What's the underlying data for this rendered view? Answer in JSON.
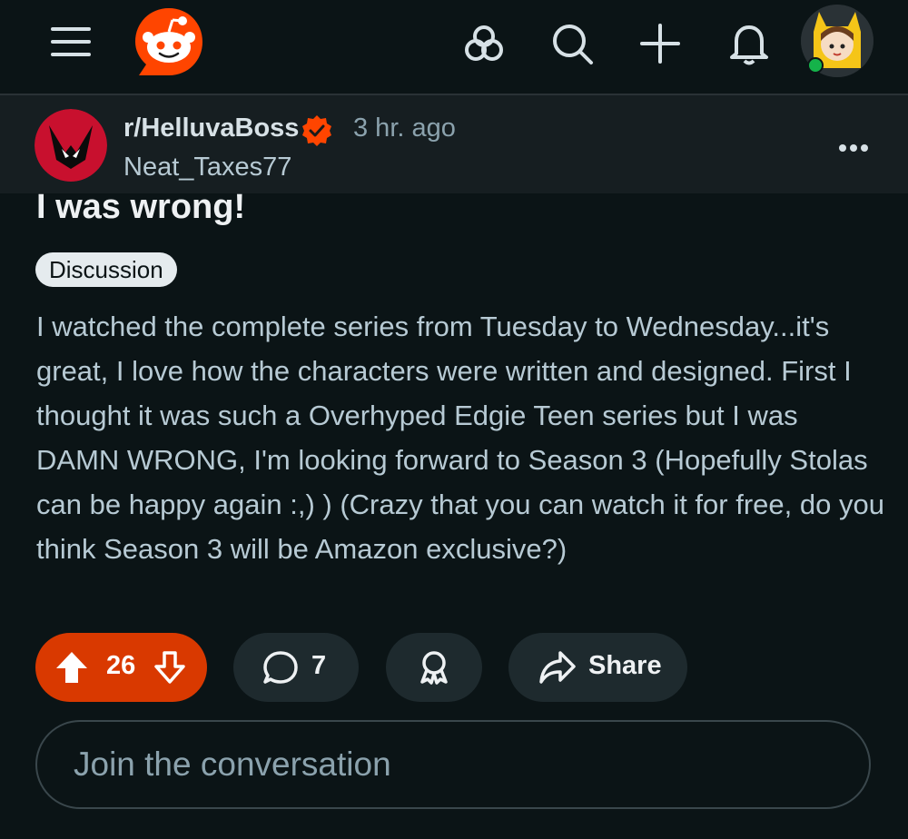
{
  "header": {
    "icons": [
      "menu-icon",
      "reddit-logo",
      "explore-icon",
      "search-icon",
      "create-icon",
      "bell-icon",
      "user-avatar"
    ]
  },
  "post": {
    "subreddit": "r/HelluvaBoss",
    "time": "3 hr. ago",
    "author": "Neat_Taxes77",
    "title": "I was wrong!",
    "flair": "Discussion",
    "body": "I watched the complete series from Tuesday to Wednesday...it's great, I love how the characters were written and designed. First I thought it was such a Overhyped Edgie Teen series but I was DAMN WRONG, I'm looking forward to Season 3 (Hopefully Stolas can be happy again :,) ) (Crazy that you can watch it for free, do you think Season 3 will be Amazon exclusive?)"
  },
  "actions": {
    "votes": "26",
    "comments": "7",
    "share_label": "Share"
  },
  "comment_box": {
    "placeholder": "Join the conversation"
  },
  "colors": {
    "background": "#0b1416",
    "vote_accent": "#d93900",
    "reddit_orange": "#ff4500"
  }
}
